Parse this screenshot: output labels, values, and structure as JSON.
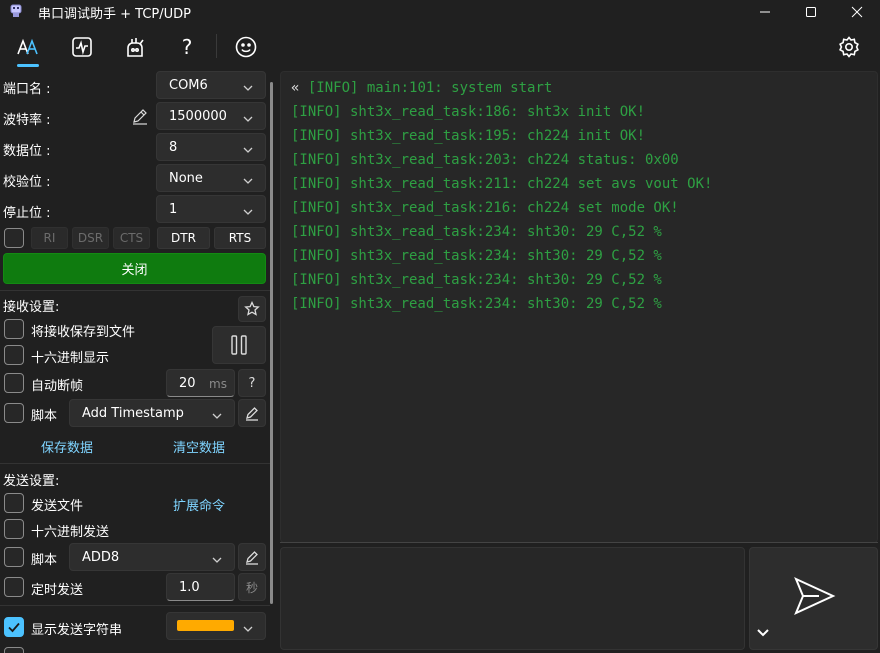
{
  "title": "串口调试助手 + TCP/UDP",
  "colors": {
    "accent": "#4cc2ff",
    "log_green": "#2ea043",
    "open_button": "#0f7b0f",
    "send_string_color": "#ffaa00"
  },
  "toolbar": {
    "icons": [
      "serial-tool-icon",
      "waveform-icon",
      "chart-tool-icon",
      "help-icon",
      "smiley-icon",
      "gear-icon"
    ],
    "help_label": "?"
  },
  "serial": {
    "port_label": "端口名 :",
    "port_value": "COM6",
    "baud_label": "波特率 :",
    "baud_value": "1500000",
    "databits_label": "数据位 :",
    "databits_value": "8",
    "parity_label": "校验位 :",
    "parity_value": "None",
    "stopbits_label": "停止位 :",
    "stopbits_value": "1",
    "pins": {
      "ri": "RI",
      "dsr": "DSR",
      "cts": "CTS",
      "dtr": "DTR",
      "rts": "RTS"
    },
    "close_button": "关闭"
  },
  "receive": {
    "header": "接收设置:",
    "save_to_file": "将接收保存到文件",
    "hex_display": "十六进制显示",
    "auto_frame": "自动断帧",
    "auto_frame_value": "20",
    "auto_frame_unit": "ms",
    "auto_frame_help": "?",
    "script_label": "脚本",
    "script_value": "Add Timestamp",
    "save_data": "保存数据",
    "clear_data": "清空数据"
  },
  "send": {
    "header": "发送设置:",
    "send_file": "发送文件",
    "extend_cmd": "扩展命令",
    "hex_send": "十六进制发送",
    "script_label": "脚本",
    "script_value": "ADD8",
    "timed_send": "定时发送",
    "timed_value": "1.0",
    "timed_unit": "秒",
    "show_send_string": "显示发送字符串"
  },
  "console": {
    "marker": "«",
    "lines": [
      "[INFO] main:101: system start",
      "[INFO] sht3x_read_task:186: sht3x init OK!",
      "[INFO] sht3x_read_task:195: ch224 init OK!",
      "[INFO] sht3x_read_task:203: ch224 status: 0x00",
      "[INFO] sht3x_read_task:211: ch224 set avs vout OK!",
      "[INFO] sht3x_read_task:216: ch224 set mode OK!",
      "[INFO] sht3x_read_task:234: sht30: 29 C,52 %",
      "[INFO] sht3x_read_task:234: sht30: 29 C,52 %",
      "[INFO] sht3x_read_task:234: sht30: 29 C,52 %",
      "[INFO] sht3x_read_task:234: sht30: 29 C,52 %"
    ]
  }
}
